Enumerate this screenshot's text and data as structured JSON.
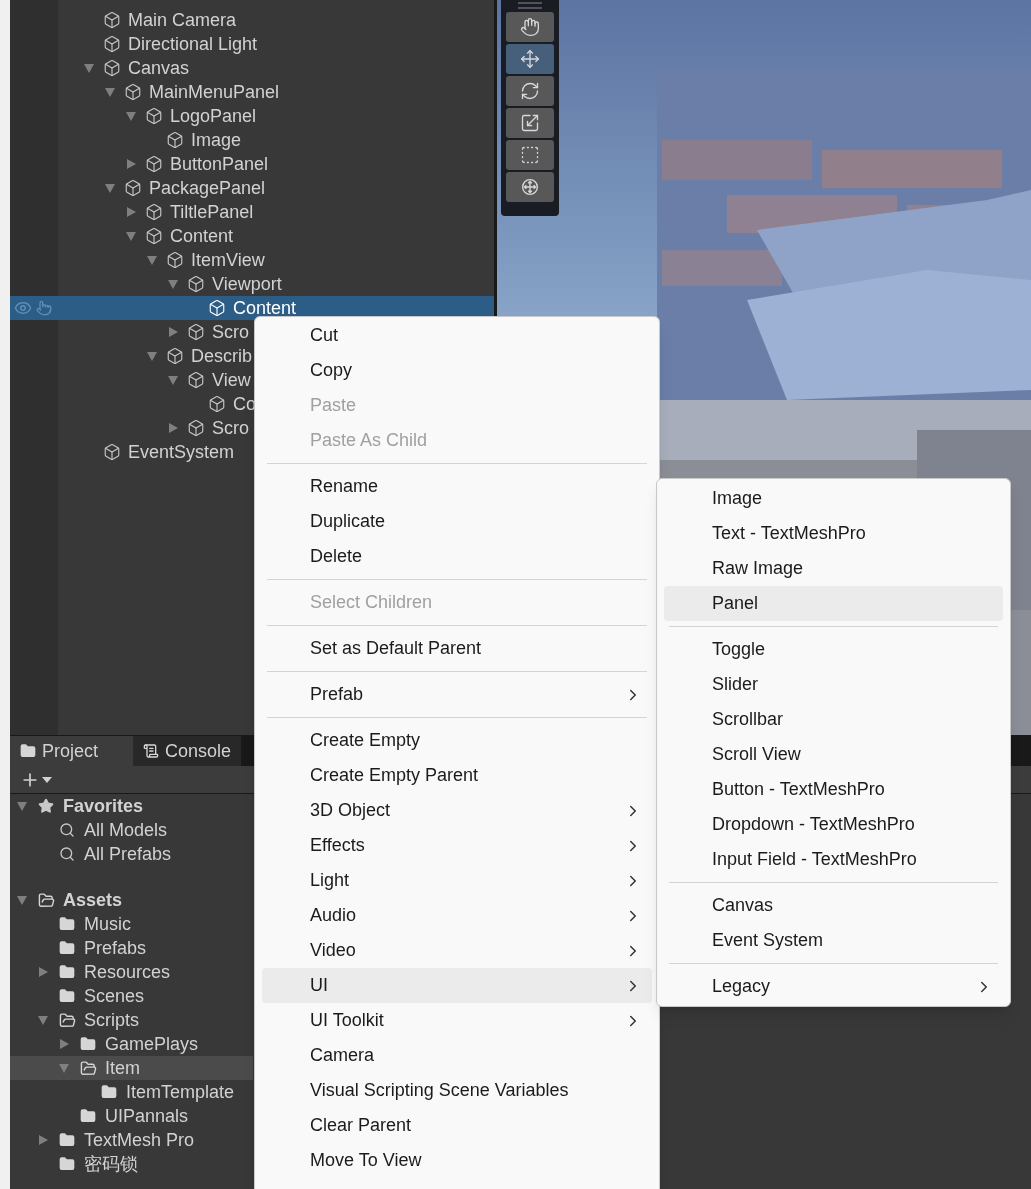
{
  "hierarchy": {
    "items": [
      {
        "label": "Main Camera",
        "selected": false
      },
      {
        "label": "Directional Light",
        "selected": false
      },
      {
        "label": "Canvas",
        "selected": false,
        "expanded": true,
        "children": [
          {
            "label": "MainMenuPanel",
            "selected": false,
            "expanded": true,
            "children": [
              {
                "label": "LogoPanel",
                "selected": false,
                "expanded": true,
                "children": [
                  {
                    "label": "Image",
                    "selected": false
                  }
                ]
              },
              {
                "label": "ButtonPanel",
                "selected": false,
                "expanded": false
              }
            ]
          },
          {
            "label": "PackagePanel",
            "selected": false,
            "expanded": true,
            "children": [
              {
                "label": "TiltlePanel",
                "selected": false,
                "expanded": false
              },
              {
                "label": "Content",
                "selected": false,
                "expanded": true,
                "children": [
                  {
                    "label": "ItemView",
                    "selected": false,
                    "expanded": true,
                    "children": [
                      {
                        "label": "Viewport",
                        "selected": false,
                        "expanded": true,
                        "children": [
                          {
                            "label": "Content",
                            "selected": true
                          }
                        ]
                      },
                      {
                        "label": "Scro",
                        "selected": false,
                        "expanded": false
                      }
                    ]
                  },
                  {
                    "label": "Describ",
                    "selected": false,
                    "expanded": true,
                    "children": [
                      {
                        "label": "View",
                        "selected": false,
                        "expanded": true,
                        "children": [
                          {
                            "label": "Co",
                            "selected": false
                          }
                        ]
                      },
                      {
                        "label": "Scro",
                        "selected": false,
                        "expanded": false
                      }
                    ]
                  }
                ]
              }
            ]
          }
        ]
      },
      {
        "label": "EventSystem",
        "selected": false
      }
    ]
  },
  "scene_tools": [
    {
      "kind": "hand",
      "selected": false
    },
    {
      "kind": "move",
      "selected": true
    },
    {
      "kind": "rotate",
      "selected": false
    },
    {
      "kind": "scale",
      "selected": false
    },
    {
      "kind": "rect",
      "selected": false
    },
    {
      "kind": "transform",
      "selected": false
    }
  ],
  "project": {
    "tabs": [
      {
        "label": "Project",
        "kind": "folder",
        "selected": true
      },
      {
        "label": "Console",
        "kind": "console",
        "selected": false
      }
    ],
    "tree": [
      {
        "label": "Favorites",
        "kind": "favorites",
        "selected": false,
        "expanded": true,
        "children": [
          {
            "label": "All Models",
            "kind": "search",
            "selected": false
          },
          {
            "label": "All Prefabs",
            "kind": "search",
            "selected": false
          }
        ]
      },
      {
        "label": "Assets",
        "kind": "folder",
        "selected": false,
        "expanded": true,
        "children": [
          {
            "label": "Music",
            "kind": "folder",
            "selected": false
          },
          {
            "label": "Prefabs",
            "kind": "folder",
            "selected": false
          },
          {
            "label": "Resources",
            "kind": "folder",
            "selected": false,
            "expanded": false
          },
          {
            "label": "Scenes",
            "kind": "folder",
            "selected": false
          },
          {
            "label": "Scripts",
            "kind": "folder",
            "selected": false,
            "expanded": true,
            "children": [
              {
                "label": "GamePlays",
                "kind": "folder",
                "selected": false,
                "expanded": false
              },
              {
                "label": "Item",
                "kind": "folder",
                "selected": true,
                "expanded": true,
                "children": [
                  {
                    "label": "ItemTemplate",
                    "kind": "folder",
                    "selected": false
                  }
                ]
              },
              {
                "label": "UIPannals",
                "kind": "folder",
                "selected": false
              }
            ]
          },
          {
            "label": "TextMesh Pro",
            "kind": "folder",
            "selected": false,
            "expanded": false
          },
          {
            "label": "密码锁",
            "kind": "folder",
            "selected": false
          }
        ]
      }
    ]
  },
  "context_menu": {
    "items": [
      {
        "kind": "item",
        "label": "Cut",
        "disabled": false,
        "submenu": false,
        "selected": false
      },
      {
        "kind": "item",
        "label": "Copy",
        "disabled": false,
        "submenu": false,
        "selected": false
      },
      {
        "kind": "item",
        "label": "Paste",
        "disabled": true,
        "submenu": false,
        "selected": false
      },
      {
        "kind": "item",
        "label": "Paste As Child",
        "disabled": true,
        "submenu": false,
        "selected": false
      },
      {
        "kind": "separator"
      },
      {
        "kind": "item",
        "label": "Rename",
        "disabled": false,
        "submenu": false,
        "selected": false
      },
      {
        "kind": "item",
        "label": "Duplicate",
        "disabled": false,
        "submenu": false,
        "selected": false
      },
      {
        "kind": "item",
        "label": "Delete",
        "disabled": false,
        "submenu": false,
        "selected": false
      },
      {
        "kind": "separator"
      },
      {
        "kind": "item",
        "label": "Select Children",
        "disabled": true,
        "submenu": false,
        "selected": false
      },
      {
        "kind": "separator"
      },
      {
        "kind": "item",
        "label": "Set as Default Parent",
        "disabled": false,
        "submenu": false,
        "selected": false
      },
      {
        "kind": "separator"
      },
      {
        "kind": "item",
        "label": "Prefab",
        "disabled": false,
        "submenu": true,
        "selected": false
      },
      {
        "kind": "separator"
      },
      {
        "kind": "item",
        "label": "Create Empty",
        "disabled": false,
        "submenu": false,
        "selected": false
      },
      {
        "kind": "item",
        "label": "Create Empty Parent",
        "disabled": false,
        "submenu": false,
        "selected": false
      },
      {
        "kind": "item",
        "label": "3D Object",
        "disabled": false,
        "submenu": true,
        "selected": false
      },
      {
        "kind": "item",
        "label": "Effects",
        "disabled": false,
        "submenu": true,
        "selected": false
      },
      {
        "kind": "item",
        "label": "Light",
        "disabled": false,
        "submenu": true,
        "selected": false
      },
      {
        "kind": "item",
        "label": "Audio",
        "disabled": false,
        "submenu": true,
        "selected": false
      },
      {
        "kind": "item",
        "label": "Video",
        "disabled": false,
        "submenu": true,
        "selected": false
      },
      {
        "kind": "item",
        "label": "UI",
        "disabled": false,
        "submenu": true,
        "selected": true
      },
      {
        "kind": "item",
        "label": "UI Toolkit",
        "disabled": false,
        "submenu": true,
        "selected": false
      },
      {
        "kind": "item",
        "label": "Camera",
        "disabled": false,
        "submenu": false,
        "selected": false
      },
      {
        "kind": "item",
        "label": "Visual Scripting Scene Variables",
        "disabled": false,
        "submenu": false,
        "selected": false
      },
      {
        "kind": "item",
        "label": "Clear Parent",
        "disabled": false,
        "submenu": false,
        "selected": false
      },
      {
        "kind": "item",
        "label": "Move To View",
        "disabled": false,
        "submenu": false,
        "selected": false
      }
    ]
  },
  "ui_submenu": {
    "items": [
      {
        "kind": "item",
        "label": "Image",
        "disabled": false,
        "submenu": false,
        "selected": false
      },
      {
        "kind": "item",
        "label": "Text - TextMeshPro",
        "disabled": false,
        "submenu": false,
        "selected": false
      },
      {
        "kind": "item",
        "label": "Raw Image",
        "disabled": false,
        "submenu": false,
        "selected": false
      },
      {
        "kind": "item",
        "label": "Panel",
        "disabled": false,
        "submenu": false,
        "selected": true
      },
      {
        "kind": "separator"
      },
      {
        "kind": "item",
        "label": "Toggle",
        "disabled": false,
        "submenu": false,
        "selected": false
      },
      {
        "kind": "item",
        "label": "Slider",
        "disabled": false,
        "submenu": false,
        "selected": false
      },
      {
        "kind": "item",
        "label": "Scrollbar",
        "disabled": false,
        "submenu": false,
        "selected": false
      },
      {
        "kind": "item",
        "label": "Scroll View",
        "disabled": false,
        "submenu": false,
        "selected": false
      },
      {
        "kind": "item",
        "label": "Button - TextMeshPro",
        "disabled": false,
        "submenu": false,
        "selected": false
      },
      {
        "kind": "item",
        "label": "Dropdown - TextMeshPro",
        "disabled": false,
        "submenu": false,
        "selected": false
      },
      {
        "kind": "item",
        "label": "Input Field - TextMeshPro",
        "disabled": false,
        "submenu": false,
        "selected": false
      },
      {
        "kind": "separator"
      },
      {
        "kind": "item",
        "label": "Canvas",
        "disabled": false,
        "submenu": false,
        "selected": false
      },
      {
        "kind": "item",
        "label": "Event System",
        "disabled": false,
        "submenu": false,
        "selected": false
      },
      {
        "kind": "separator"
      },
      {
        "kind": "item",
        "label": "Legacy",
        "disabled": false,
        "submenu": true,
        "selected": false
      }
    ]
  }
}
